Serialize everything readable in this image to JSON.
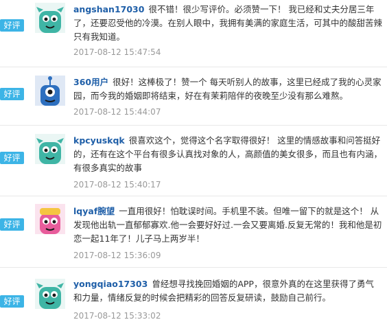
{
  "reviews": [
    {
      "badge": "好评",
      "username": "angshan17030",
      "text": "很不错！很少写评价。必须赞一下！ 我已经和丈夫分居三年了，还要忍受他的冷漠。在别人眼中，我拥有美满的家庭生活，可其中的酸甜苦辣只有我知道。",
      "time": "2017-08-12 15:47:54",
      "avatar": "teal-monster-avatar",
      "colors": {
        "bg": "#eaf6f4",
        "body": "#3fb5a5"
      }
    },
    {
      "badge": "好评",
      "username": "360用户",
      "text": "很好！这棒极了！赞一个 每天听别人的故事，这里已经成了我的心灵家园，而今我的婚姻即将结束，好在有茉莉陪伴的夜晚至少没有那么难熬。",
      "time": "2017-08-12 15:44:07",
      "avatar": "blue-monster-avatar",
      "colors": {
        "bg": "#dfe8f5",
        "body": "#2d6fbf"
      }
    },
    {
      "badge": "好评",
      "username": "kpcyuskqk",
      "text": "很喜欢这个，觉得这个名字取得很好！ 这里的情感故事和问答挺好的，还有在这个平台有很多认真找对象的人，高颜值的美女很多，而且也有内涵，有很多真实的故事",
      "time": "2017-08-12 15:40:17",
      "avatar": "teal-monster-avatar",
      "colors": {
        "bg": "#eaf6f4",
        "body": "#3fb5a5"
      }
    },
    {
      "badge": "好评",
      "username": "lqyaf腕望",
      "text": "一直用很好！怕耽误时间。手机里不装。但唯一留下的就是这个！ 从发现他出轨一直郁郁寡欢.他一会要好好过.一会又要离婚.反复无常的！我和他是初恋一起11年了！儿子马上两岁半！",
      "time": "2017-08-12 15:36:09",
      "avatar": "pink-monster-avatar",
      "colors": {
        "bg": "#fbe3ee",
        "body": "#e85c9b"
      }
    },
    {
      "badge": "好评",
      "username": "yongqiao17303",
      "text": "曾经想寻找挽回婚姻的APP，很意外真的在这里获得了勇气和力量，情绪反复的时候会把精彩的回答反复研读，鼓励自己前行。",
      "time": "2017-08-12 15:33:02",
      "avatar": "teal-monster-avatar",
      "colors": {
        "bg": "#eaf6f4",
        "body": "#3fb5a5"
      }
    }
  ],
  "badge_color": "#3cb4e6",
  "username_color": "#1f5fa8",
  "time_color": "#999999"
}
